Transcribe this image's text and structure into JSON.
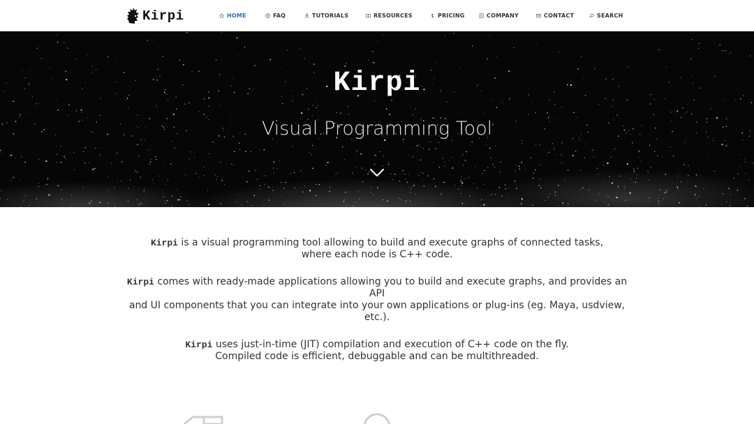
{
  "brand": {
    "name": "Kirpi",
    "logo_icon": "hedgehog-logo-icon"
  },
  "nav": {
    "items": [
      {
        "label": "HOME",
        "icon": "home-icon",
        "active": true
      },
      {
        "label": "FAQ",
        "icon": "question-icon",
        "active": false
      },
      {
        "label": "TUTORIALS",
        "icon": "user-icon",
        "active": false
      },
      {
        "label": "RESOURCES",
        "icon": "book-icon",
        "active": false
      },
      {
        "label": "PRICING",
        "icon": "dollar-icon",
        "active": false
      },
      {
        "label": "COMPANY",
        "icon": "building-icon",
        "active": false
      },
      {
        "label": "CONTACT",
        "icon": "envelope-icon",
        "active": false
      },
      {
        "label": "SEARCH",
        "icon": "search-icon",
        "active": false
      }
    ]
  },
  "hero": {
    "title": "Kirpi",
    "subtitle": "Visual Programming Tool",
    "scroll_icon": "chevron-down-icon"
  },
  "content": {
    "paragraphs": [
      {
        "code": "Kirpi",
        "line1": " is a visual programming tool allowing to build and execute graphs of connected tasks,",
        "line2": "where each node is C++ code."
      },
      {
        "code": "Kirpi",
        "line1": " comes with ready-made applications allowing you to build and execute graphs, and provides an API",
        "line2": "and UI components that you can integrate into your own applications or plug-ins (eg. Maya, usdview,",
        "line3": "etc.)."
      },
      {
        "code": "Kirpi",
        "line1": " uses just-in-time (JIT) compilation and execution of C++ code on the fly.",
        "line2": "Compiled code is efficient, debuggable and can be multithreaded."
      }
    ]
  },
  "colors": {
    "accent": "#2f6db5",
    "hero_bg": "#060606",
    "text": "#333333"
  }
}
